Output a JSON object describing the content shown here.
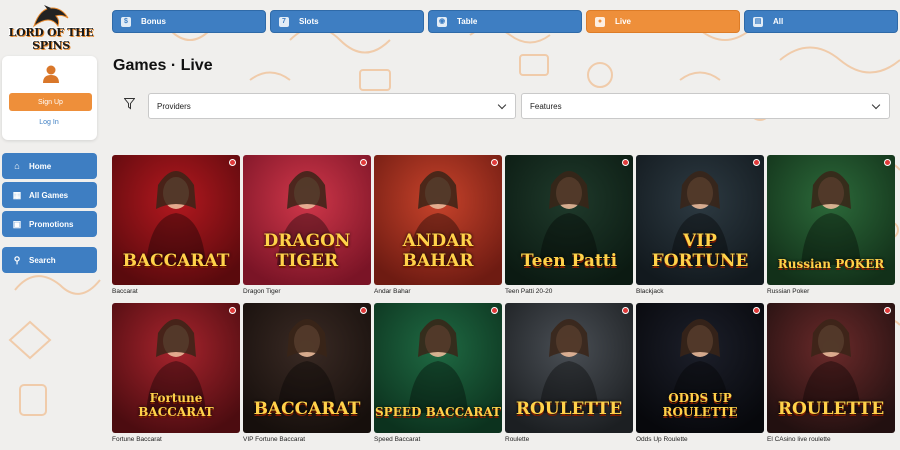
{
  "brand": {
    "logo_text": "LORD OF THE SPINS"
  },
  "top_nav": [
    {
      "label": "Bonus",
      "icon": "bonus-icon",
      "active": false
    },
    {
      "label": "Slots",
      "icon": "slots-icon",
      "active": false
    },
    {
      "label": "Table",
      "icon": "table-icon",
      "active": false
    },
    {
      "label": "Live",
      "icon": "live-icon",
      "active": true
    },
    {
      "label": "All",
      "icon": "all-icon",
      "active": false
    }
  ],
  "user": {
    "signup_label": "Sign Up",
    "login_label": "Log In"
  },
  "sidebar": {
    "items": [
      {
        "label": "Home",
        "icon": "home-icon"
      },
      {
        "label": "All Games",
        "icon": "all-games-icon"
      },
      {
        "label": "Promotions",
        "icon": "gift-icon"
      },
      {
        "label": "Search",
        "icon": "search-icon"
      }
    ]
  },
  "main": {
    "title": "Games · Live",
    "filters": {
      "providers": "Providers",
      "features": "Features"
    }
  },
  "games": [
    {
      "name": "Baccarat",
      "art": "BACCARAT"
    },
    {
      "name": "Dragon Tiger",
      "art": "DRAGON TIGER"
    },
    {
      "name": "Andar Bahar",
      "art": "ANDAR BAHAR"
    },
    {
      "name": "Teen Patti 20-20",
      "art": "Teen Patti"
    },
    {
      "name": "Blackjack",
      "art": "VIP FORTUNE"
    },
    {
      "name": "Russian Poker",
      "art": "Russian POKER"
    },
    {
      "name": "Fortune Baccarat",
      "art": "Fortune BACCARAT"
    },
    {
      "name": "VIP Fortune Baccarat",
      "art": "BACCARAT"
    },
    {
      "name": "Speed Baccarat",
      "art": "SPEED BACCARAT"
    },
    {
      "name": "Roulette",
      "art": "ROULETTE"
    },
    {
      "name": "Odds Up Roulette",
      "art": "ODDS UP ROULETTE"
    },
    {
      "name": "El CAsino live roulette",
      "art": "ROULETTE"
    }
  ],
  "colors": {
    "primary": "#3e7ec2",
    "accent": "#ee8f3a",
    "background": "#f0efed"
  }
}
